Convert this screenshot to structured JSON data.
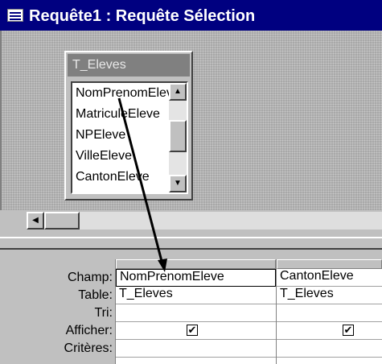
{
  "window": {
    "title": "Requête1 : Requête Sélection"
  },
  "table_box": {
    "name": "T_Eleves",
    "fields": [
      "NomPrenomEleve",
      "MatriculeEleve",
      "NPEleve",
      "VilleEleve",
      "CantonEleve"
    ]
  },
  "grid": {
    "row_labels": [
      "Champ:",
      "Table:",
      "Tri:",
      "Afficher:",
      "Critères:"
    ],
    "columns": [
      {
        "champ": "NomPrenomEleve",
        "table": "T_Eleves",
        "tri": "",
        "afficher": true
      },
      {
        "champ": "CantonEleve",
        "table": "T_Eleves",
        "tri": "",
        "afficher": true
      }
    ]
  },
  "icons": {
    "window_icon": "query-icon",
    "scroll_up": "arrow-up-icon",
    "scroll_down": "arrow-down-icon",
    "scroll_left": "arrow-left-icon",
    "checkmark": "checkmark-icon"
  },
  "colors": {
    "titlebar": "#000080",
    "face": "#c0c0c0"
  }
}
